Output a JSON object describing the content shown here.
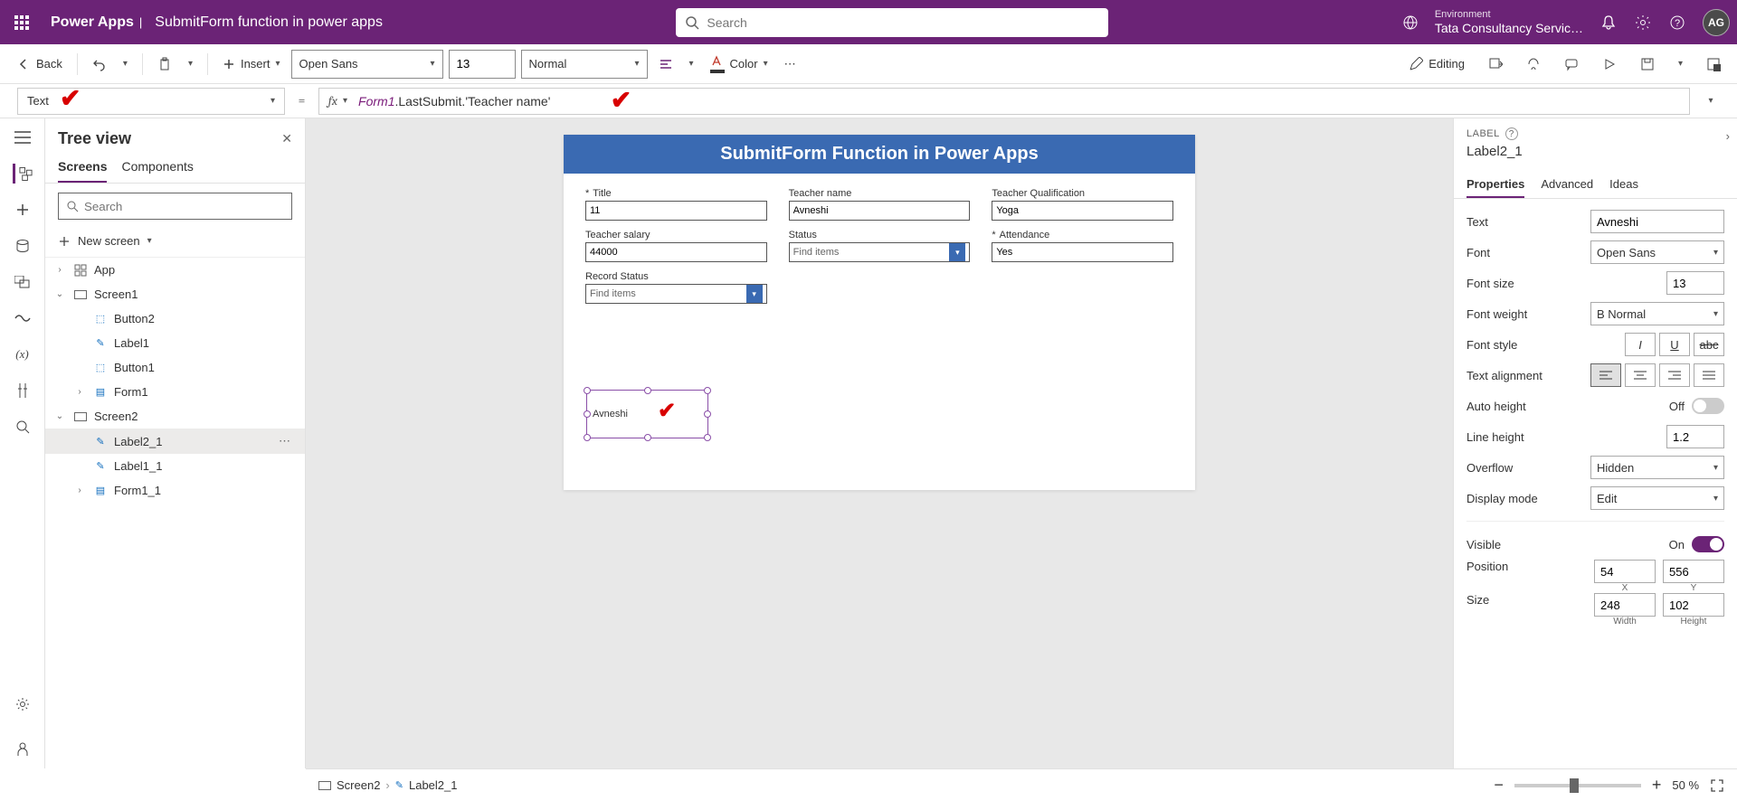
{
  "header": {
    "app": "Power Apps",
    "page": "SubmitForm function in power apps",
    "search_placeholder": "Search",
    "env_label": "Environment",
    "env_name": "Tata Consultancy Servic…",
    "avatar": "AG"
  },
  "toolbar": {
    "back": "Back",
    "insert": "Insert",
    "font": "Open Sans",
    "size": "13",
    "weight": "Normal",
    "color": "Color",
    "editing": "Editing"
  },
  "formula": {
    "property": "Text",
    "expr_fn": "Form1",
    "expr_rest": ".LastSubmit.'Teacher name'"
  },
  "tree": {
    "title": "Tree view",
    "tabs": {
      "screens": "Screens",
      "components": "Components"
    },
    "search_placeholder": "Search",
    "new_screen": "New screen",
    "items": {
      "app": "App",
      "screen1": "Screen1",
      "button2": "Button2",
      "label1": "Label1",
      "button1": "Button1",
      "form1": "Form1",
      "screen2": "Screen2",
      "label2_1": "Label2_1",
      "label1_1": "Label1_1",
      "form1_1": "Form1_1"
    }
  },
  "canvas": {
    "title": "SubmitForm Function in Power Apps",
    "fields": {
      "title_label": "Title",
      "title_value": "11",
      "name_label": "Teacher name",
      "name_value": "Avneshi",
      "qual_label": "Teacher Qualification",
      "qual_value": "Yoga",
      "salary_label": "Teacher salary",
      "salary_value": "44000",
      "status_label": "Status",
      "status_value": "Find items",
      "attend_label": "Attendance",
      "attend_value": "Yes",
      "record_label": "Record Status",
      "record_value": "Find items"
    },
    "selected_label_text": "Avneshi"
  },
  "props": {
    "type": "LABEL",
    "name": "Label2_1",
    "tabs": {
      "properties": "Properties",
      "advanced": "Advanced",
      "ideas": "Ideas"
    },
    "rows": {
      "text_label": "Text",
      "text_value": "Avneshi",
      "font_label": "Font",
      "font_value": "Open Sans",
      "size_label": "Font size",
      "size_value": "13",
      "weight_label": "Font weight",
      "weight_value": "B  Normal",
      "style_label": "Font style",
      "align_label": "Text alignment",
      "autoh_label": "Auto height",
      "autoh_value": "Off",
      "lineh_label": "Line height",
      "lineh_value": "1.2",
      "overflow_label": "Overflow",
      "overflow_value": "Hidden",
      "dmode_label": "Display mode",
      "dmode_value": "Edit",
      "visible_label": "Visible",
      "visible_value": "On",
      "pos_label": "Position",
      "pos_x": "54",
      "pos_y": "556",
      "pos_x_sub": "X",
      "pos_y_sub": "Y",
      "size_label2": "Size",
      "size_w": "248",
      "size_h": "102",
      "size_w_sub": "Width",
      "size_h_sub": "Height"
    }
  },
  "status": {
    "breadcrumb1": "Screen2",
    "breadcrumb2": "Label2_1",
    "zoom": "50",
    "zoom_pct": "%"
  }
}
